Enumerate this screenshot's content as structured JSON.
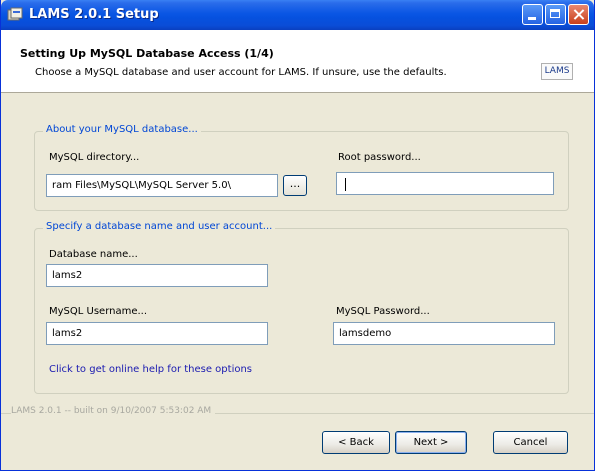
{
  "window": {
    "title": "LAMS 2.0.1 Setup",
    "controls": [
      "minimize-icon",
      "maximize-icon",
      "close-icon"
    ]
  },
  "header": {
    "title": "Setting Up MySQL Database Access (1/4)",
    "subtitle": "Choose a MySQL database and user account for LAMS.  If unsure, use the defaults.",
    "logo": "LAMS"
  },
  "mysql_group": {
    "label": "About your MySQL database...",
    "directory_label": "MySQL directory...",
    "directory_value": "ram Files\\MySQL\\MySQL Server 5.0\\",
    "browse_label": "...",
    "root_password_label": "Root password...",
    "root_password_value": ""
  },
  "db_group": {
    "label": "Specify a database name and user account...",
    "db_name_label": "Database name...",
    "db_name_value": "lams2",
    "username_label": "MySQL Username...",
    "username_value": "lams2",
    "password_label": "MySQL Password...",
    "password_value": "lamsdemo",
    "help_link": "Click to get online help for these options"
  },
  "footer": {
    "version": "LAMS 2.0.1 -- built on 9/10/2007 5:53:02 AM",
    "back_label": "< Back",
    "next_label": "Next >",
    "cancel_label": "Cancel"
  }
}
